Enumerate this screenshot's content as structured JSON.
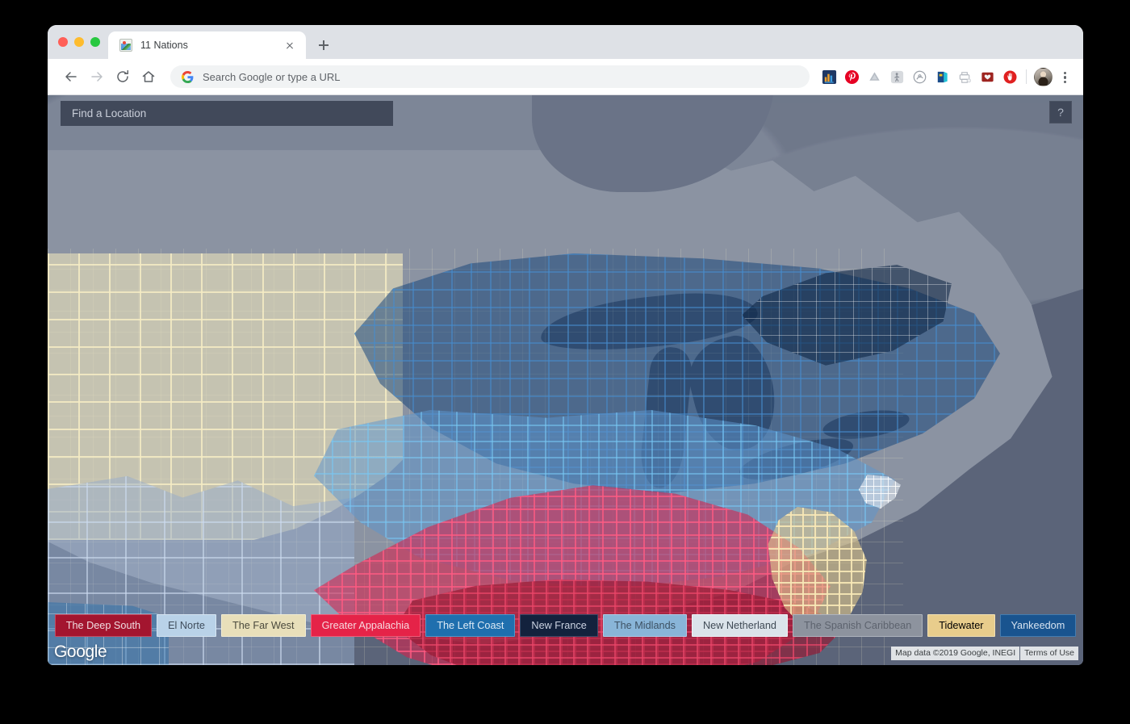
{
  "window": {
    "traffic_lights": [
      "close",
      "minimize",
      "maximize"
    ]
  },
  "tab": {
    "title": "11 Nations",
    "favicon": "image-favicon",
    "close_label": "",
    "new_tab_label": ""
  },
  "toolbar": {
    "back": "back-arrow-icon",
    "forward": "forward-arrow-icon",
    "reload": "reload-icon",
    "home": "home-icon",
    "omnibox_placeholder": "Search Google or type a URL",
    "omnibox_value": "",
    "extensions": [
      {
        "name": "bar-chart-extension-icon",
        "glyph": "chart"
      },
      {
        "name": "pinterest-extension-icon",
        "glyph": "pinterest"
      },
      {
        "name": "google-drive-extension-icon",
        "glyph": "drive"
      },
      {
        "name": "figure-extension-icon",
        "glyph": "figure"
      },
      {
        "name": "circle-extension-icon",
        "glyph": "circle"
      },
      {
        "name": "blue-book-extension-icon",
        "glyph": "book"
      },
      {
        "name": "printer-extension-icon",
        "glyph": "printer"
      },
      {
        "name": "red-folder-heart-extension-icon",
        "glyph": "folderheart"
      },
      {
        "name": "adblock-shield-extension-icon",
        "glyph": "adblock"
      }
    ],
    "profile": "user-avatar",
    "menu": "kebab-menu-icon"
  },
  "map": {
    "search_placeholder": "Find a Location",
    "search_value": "",
    "help_label": "?",
    "watermark": "Google",
    "attribution": "Map data ©2019 Google, INEGI",
    "terms": "Terms of Use"
  },
  "legend": {
    "items": [
      {
        "label": "The Deep South",
        "bg": "#a3152f",
        "border": "#c44a60",
        "text": "#f0dde1"
      },
      {
        "label": "El Norte",
        "bg": "#b9d2e8",
        "border": "#d6e5f2",
        "text": "#3f4d5c"
      },
      {
        "label": "The Far West",
        "bg": "#e8dfba",
        "border": "#f2ecd2",
        "text": "#4b4a3d"
      },
      {
        "label": "Greater Appalachia",
        "bg": "#e52348",
        "border": "#f05d78",
        "text": "#f7d9df"
      },
      {
        "label": "The Left Coast",
        "bg": "#1f6fae",
        "border": "#4f96c9",
        "text": "#dceaf5"
      },
      {
        "label": "New France",
        "bg": "#13223d",
        "border": "#3b4a68",
        "text": "#cbd3e2"
      },
      {
        "label": "The Midlands",
        "bg": "#89b5d8",
        "border": "#aecbe6",
        "text": "#3d5163"
      },
      {
        "label": "New Netherland",
        "bg": "#dbe3ea",
        "border": "#eef2f6",
        "text": "#3f4a55"
      },
      {
        "label": "The Spanish Caribbean",
        "bg": "#8d939e",
        "border": "#aeb4bd",
        "text": "#5d636e"
      },
      {
        "label": "Tidewater",
        "bg": "#e8cd8c",
        "border": "#f2e0b3",
        "text": "#4d4staging"
      },
      {
        "label": "Yankeedom",
        "bg": "#19548f",
        "border": "#447cb0",
        "text": "#d6e3f0"
      }
    ]
  },
  "nations_on_map": [
    {
      "name": "The Far West",
      "color": "#e9e0b9"
    },
    {
      "name": "El Norte",
      "color": "#96accc"
    },
    {
      "name": "The Left Coast",
      "color": "#246eaa"
    },
    {
      "name": "Yankeedom",
      "color": "#154378"
    },
    {
      "name": "New France",
      "color": "#0a2040"
    },
    {
      "name": "The Midlands",
      "color": "#5d96cd"
    },
    {
      "name": "Greater Appalachia",
      "color": "#d6204c"
    },
    {
      "name": "The Deep South",
      "color": "#98142d"
    },
    {
      "name": "Tidewater",
      "color": "#e1c88c"
    },
    {
      "name": "New Netherland",
      "color": "#e1e8f0"
    }
  ]
}
